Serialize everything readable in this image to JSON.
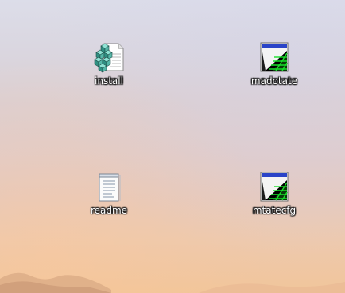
{
  "desktop": {
    "icons": [
      {
        "label": "install",
        "icon": "registry-entries-icon"
      },
      {
        "label": "madotate",
        "icon": "game-application-icon"
      },
      {
        "label": "readme",
        "icon": "text-document-icon"
      },
      {
        "label": "mtatecfg",
        "icon": "game-application-icon"
      }
    ]
  },
  "colors": {
    "label_text": "#ffffff",
    "label_shadow": "#1a1a1a",
    "sky_top": "#dcdde9",
    "sky_bottom": "#f1c59a"
  }
}
